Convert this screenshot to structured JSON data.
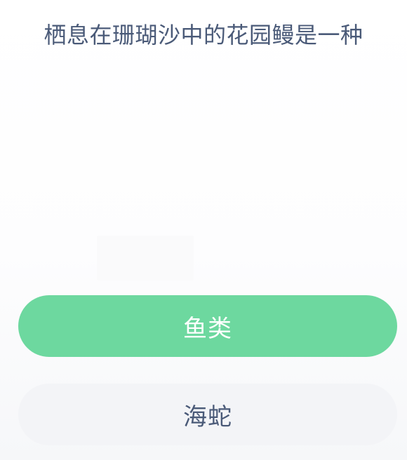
{
  "question": {
    "text": "栖息在珊瑚沙中的花园鳗是一种"
  },
  "options": [
    {
      "label": "鱼类",
      "state": "selected"
    },
    {
      "label": "海蛇",
      "state": "default"
    }
  ],
  "colors": {
    "question_text": "#4a5a78",
    "selected_option_bg": "#6dd89f",
    "selected_option_text": "#ffffff",
    "default_option_bg": "#f3f4f7",
    "default_option_text": "#4a5a78"
  }
}
